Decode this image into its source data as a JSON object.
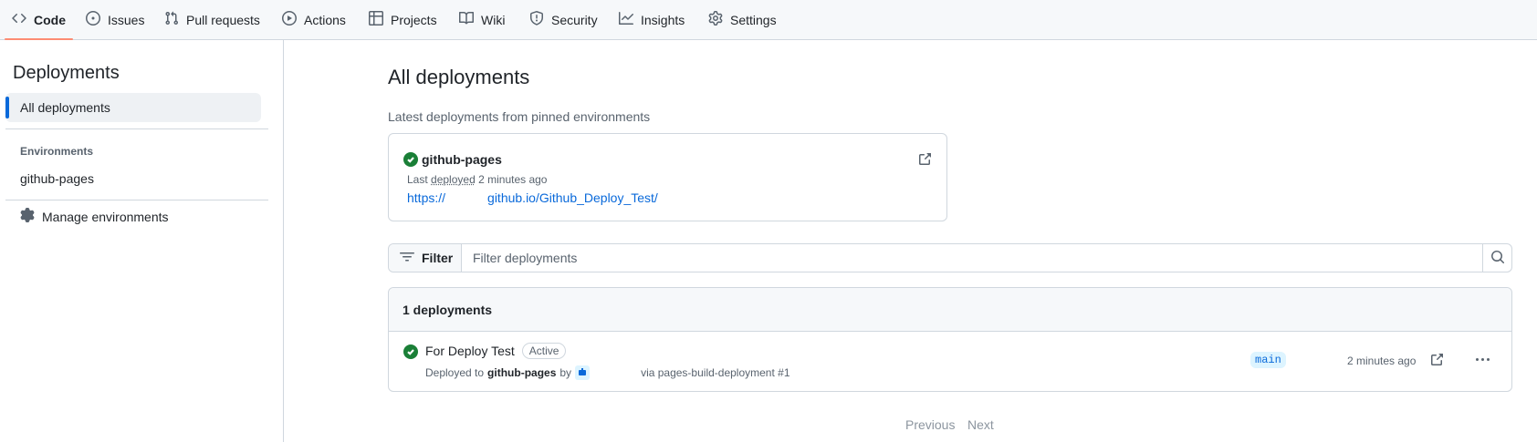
{
  "nav": {
    "tabs": [
      {
        "label": "Code",
        "icon": "code-icon"
      },
      {
        "label": "Issues",
        "icon": "issue-icon"
      },
      {
        "label": "Pull requests",
        "icon": "pull-request-icon"
      },
      {
        "label": "Actions",
        "icon": "play-icon"
      },
      {
        "label": "Projects",
        "icon": "table-icon"
      },
      {
        "label": "Wiki",
        "icon": "book-icon"
      },
      {
        "label": "Security",
        "icon": "shield-icon"
      },
      {
        "label": "Insights",
        "icon": "graph-icon"
      },
      {
        "label": "Settings",
        "icon": "gear-icon"
      }
    ],
    "active": "Code"
  },
  "sidebar": {
    "title": "Deployments",
    "active_item": "All deployments",
    "environments_heading": "Environments",
    "environments": [
      "github-pages"
    ],
    "manage_label": "Manage environments"
  },
  "main": {
    "title": "All deployments",
    "pinned_subtitle": "Latest deployments from pinned environments",
    "pinned": {
      "name": "github-pages",
      "meta_prefix": "Last",
      "meta_link": "deployed",
      "meta_time": "2 minutes ago",
      "url_start": "https://",
      "url_end": "github.io/Github_Deploy_Test/"
    },
    "filter": {
      "button_label": "Filter",
      "placeholder": "Filter deployments"
    },
    "list": {
      "count_label": "1 deployments",
      "rows": [
        {
          "title": "For Deploy Test",
          "badge": "Active",
          "deployed_to_prefix": "Deployed to",
          "environment": "github-pages",
          "by": "by",
          "via": "via pages-build-deployment #1",
          "branch": "main",
          "time": "2 minutes ago"
        }
      ]
    },
    "pagination": {
      "previous": "Previous",
      "next": "Next"
    }
  },
  "colors": {
    "accent": "#0969da",
    "success": "#1a7f37",
    "tab_underline": "#fd8c73"
  }
}
